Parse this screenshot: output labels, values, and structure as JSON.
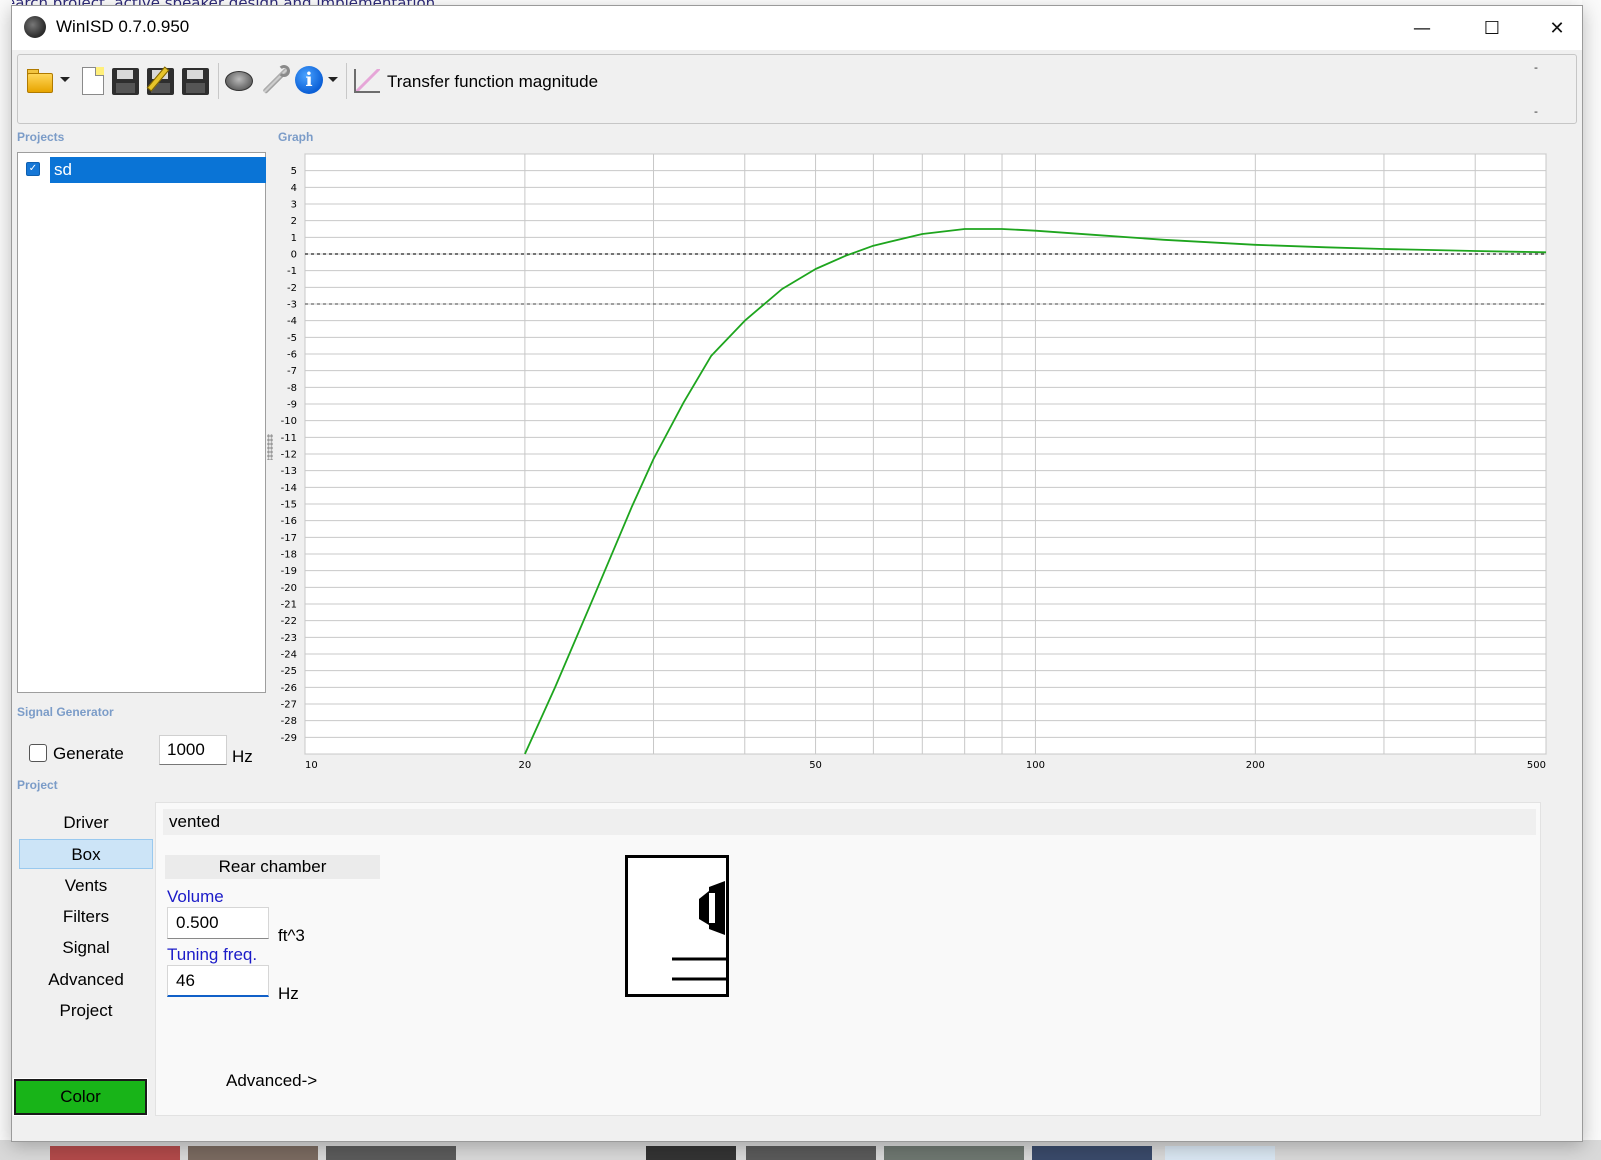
{
  "window": {
    "title": "WinISD 0.7.0.950",
    "minimize_glyph": "—",
    "maximize_glyph": "☐",
    "close_glyph": "✕"
  },
  "background": {
    "top_text": "earch project, active speaker design and implementation"
  },
  "toolbar": {
    "chart_label": "Transfer function magnitude",
    "overflow_top": "-",
    "overflow_bottom": "-",
    "icons": [
      "open-folder-icon",
      "new-project-icon",
      "save-icon",
      "save-as-icon",
      "save-all-icon",
      "driver-speaker-icon",
      "tools-wrench-icon",
      "info-icon",
      "chart-icon"
    ]
  },
  "sections": {
    "projects": "Projects",
    "graph": "Graph",
    "signal_generator": "Signal Generator",
    "project": "Project"
  },
  "projects": {
    "items": [
      {
        "name": "sd",
        "checked": true,
        "selected": true
      }
    ]
  },
  "signal_generator": {
    "generate_label": "Generate",
    "generate_checked": false,
    "frequency": "1000",
    "unit": "Hz"
  },
  "nav": {
    "items": [
      "Driver",
      "Box",
      "Vents",
      "Filters",
      "Signal",
      "Advanced",
      "Project"
    ],
    "active": "Box",
    "color_button": "Color",
    "color_value": "#18b418"
  },
  "box": {
    "type": "vented",
    "chamber_header": "Rear chamber",
    "volume_label": "Volume",
    "volume_value": "0.500",
    "volume_unit": "ft^3",
    "tuning_label": "Tuning freq.",
    "tuning_value": "46",
    "tuning_unit": "Hz",
    "advanced_link": "Advanced->"
  },
  "chart_data": {
    "type": "line",
    "title": "",
    "xlabel": "",
    "ylabel": "",
    "x_scale": "log",
    "xlim": [
      10,
      500
    ],
    "ylim": [
      -30,
      6
    ],
    "x_ticks": [
      10,
      20,
      50,
      100,
      200,
      500
    ],
    "y_ticks": [
      5,
      4,
      3,
      2,
      1,
      0,
      -1,
      -2,
      -3,
      -4,
      -5,
      -6,
      -7,
      -8,
      -9,
      -10,
      -11,
      -12,
      -13,
      -14,
      -15,
      -16,
      -17,
      -18,
      -19,
      -20,
      -21,
      -22,
      -23,
      -24,
      -25,
      -26,
      -27,
      -28,
      -29
    ],
    "grid": true,
    "reference_lines": [
      0,
      -3
    ],
    "series": [
      {
        "color": "#1ea51e",
        "x": [
          20,
          22,
          25,
          28,
          30,
          33,
          36,
          40,
          45,
          50,
          55,
          60,
          70,
          80,
          90,
          100,
          120,
          150,
          200,
          250,
          300,
          400,
          500
        ],
        "y": [
          -30,
          -26,
          -20.3,
          -15.2,
          -12.3,
          -8.9,
          -6.1,
          -4.0,
          -2.1,
          -0.9,
          -0.1,
          0.5,
          1.2,
          1.5,
          1.5,
          1.4,
          1.15,
          0.85,
          0.55,
          0.4,
          0.3,
          0.18,
          0.1
        ]
      }
    ]
  }
}
